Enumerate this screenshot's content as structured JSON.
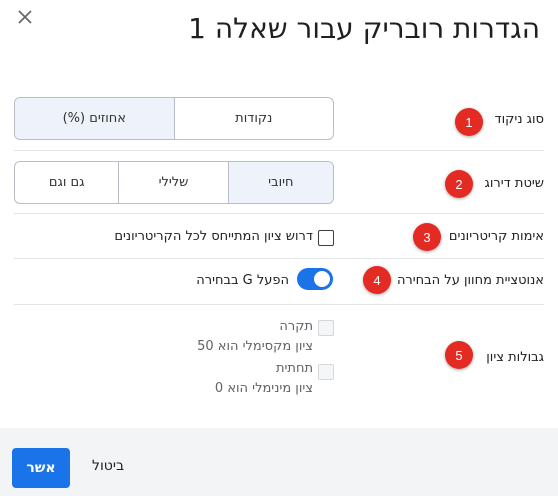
{
  "dialog": {
    "title": "הגדרות רובריק עבור שאלה 1",
    "close_icon": "close-icon"
  },
  "rows": [
    {
      "badge": "1",
      "label": "סוג ניקוד"
    },
    {
      "badge": "2",
      "label": "שיטת דירוג"
    },
    {
      "badge": "3",
      "label": "אימות קריטריונים"
    },
    {
      "badge": "4",
      "label": "אנוטציית מחוון על הבחירה"
    },
    {
      "badge": "5",
      "label": "גבולות ציון"
    }
  ],
  "scoring_type": {
    "options": [
      "נקודות",
      "אחוזים (%)"
    ],
    "selected": "אחוזים (%)"
  },
  "grading_method": {
    "options": [
      "חיובי",
      "שלילי",
      "גם וגם"
    ],
    "selected": "חיובי"
  },
  "validation": {
    "checkbox_label": "דרוש ציון המתייחס לכל הקריטריונים",
    "checked": false
  },
  "annotation": {
    "toggle_label": "הפעל G בבחירה",
    "on": true
  },
  "score_limits": {
    "ceiling_label": "תקרה",
    "ceiling_desc": "ציון מקסימלי הוא 50",
    "floor_label": "תחתית",
    "floor_desc": "ציון מינימלי הוא  0"
  },
  "footer": {
    "ok_label": "אשר",
    "cancel_label": "ביטול"
  },
  "colors": {
    "primary": "#1a73e8",
    "badge": "#e32a23"
  }
}
